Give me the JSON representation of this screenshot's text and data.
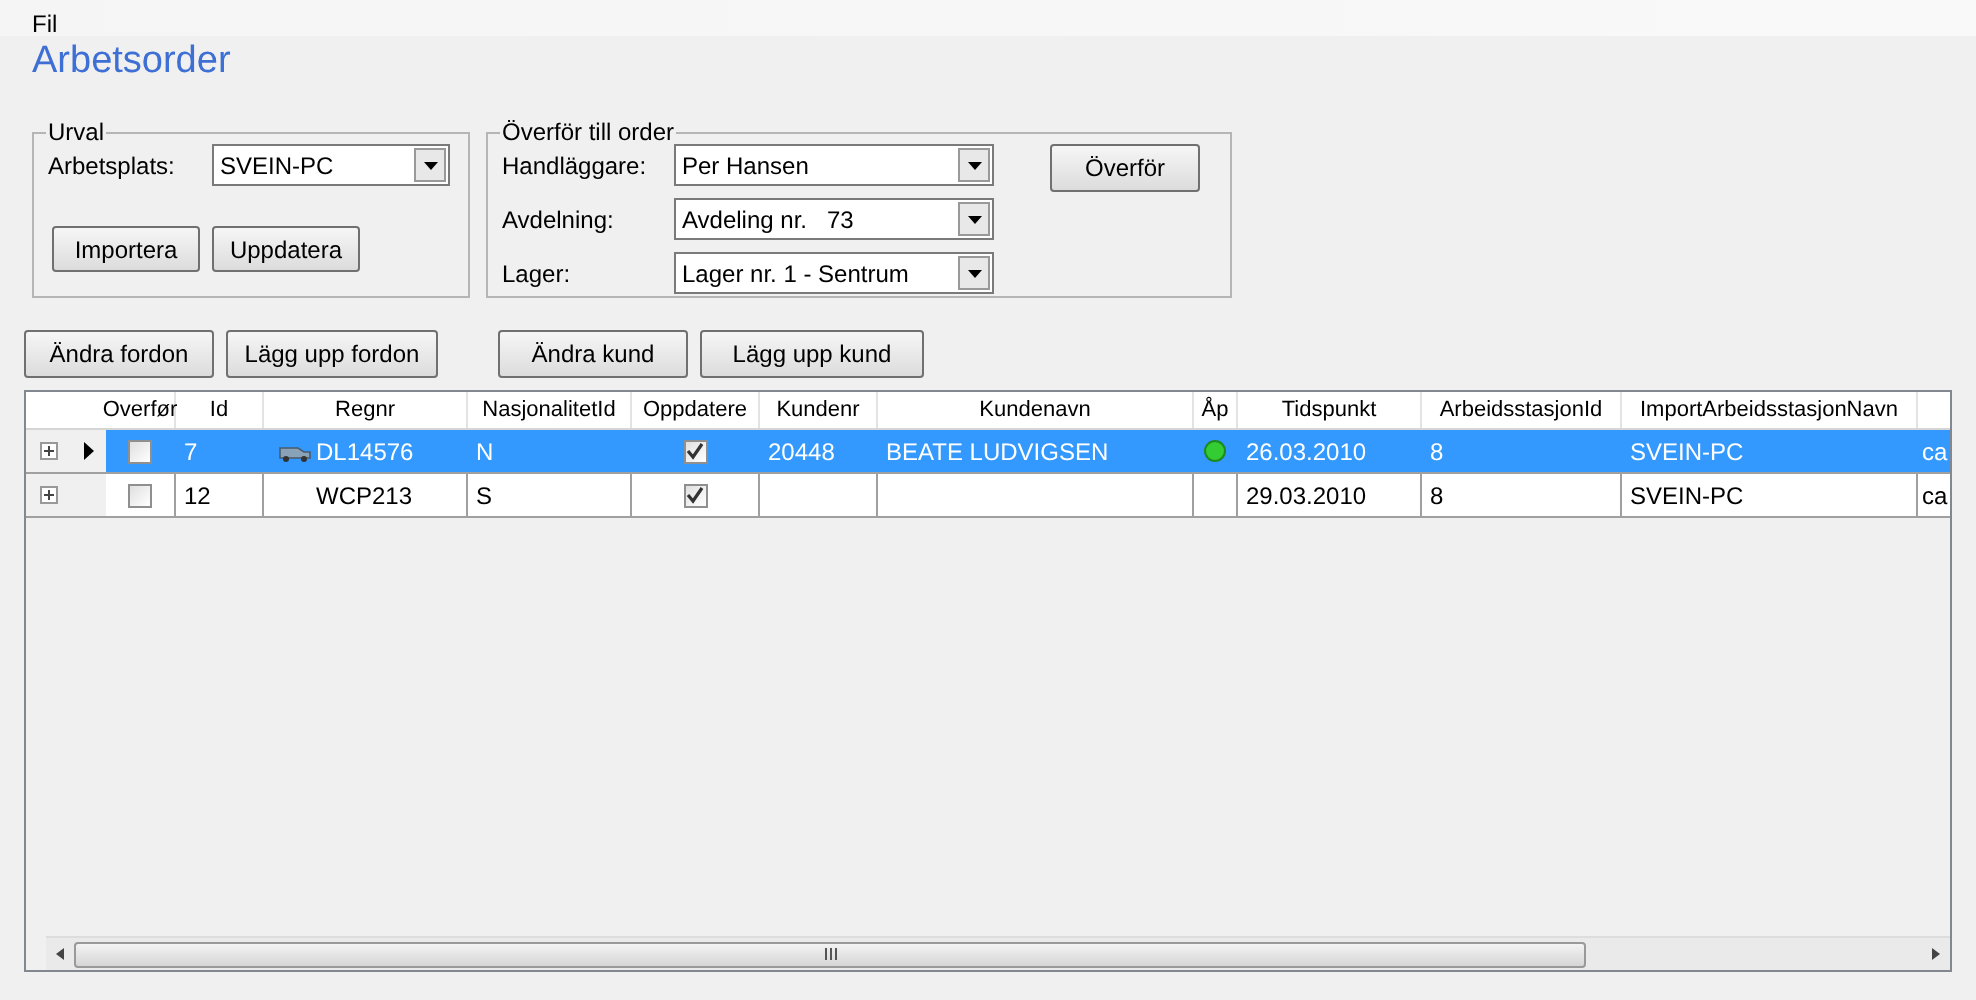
{
  "menu": [
    "Fil"
  ],
  "title": "Arbetsorder",
  "urval": {
    "legend": "Urval",
    "label": "Arbetsplats:",
    "value": "SVEIN-PC",
    "buttons": [
      "Importera",
      "Uppdatera"
    ]
  },
  "transfer": {
    "legend": "Överför till order",
    "fields": [
      {
        "label": "Handläggare:",
        "value": "Per Hansen"
      },
      {
        "label": "Avdelning:",
        "value": "Avdeling nr.   73"
      },
      {
        "label": "Lager:",
        "value": "Lager nr. 1 - Sentrum"
      }
    ],
    "button": "Överför"
  },
  "actions": [
    [
      "Ändra fordon",
      "Lägg upp fordon"
    ],
    [
      "Ändra kund",
      "Lägg upp kund"
    ]
  ],
  "table": {
    "columns": [
      "Overfør",
      "Id",
      "Regnr",
      "NasjonalitetId",
      "Oppdatere",
      "Kundenr",
      "Kundenavn",
      "Åp",
      "Tidspunkt",
      "ArbeidsstasjonId",
      "ImportArbeidsstasjonNavn"
    ],
    "rows": [
      {
        "selected": true,
        "overfor": false,
        "id": "7",
        "vehicle_icon": true,
        "regnr": "DL14576",
        "nasjonalitet": "N",
        "oppdatere": true,
        "kundenr": "20448",
        "kundenavn": "BEATE LUDVIGSEN",
        "ap": true,
        "tidspunkt": "26.03.2010",
        "stasjon": "8",
        "import": "SVEIN-PC",
        "column_12": "ca"
      },
      {
        "selected": false,
        "overfor": false,
        "id": "12",
        "vehicle_icon": false,
        "regnr": "WCP213",
        "nasjonalitet": "S",
        "oppdatere": true,
        "kundenr": "",
        "kundenavn": "",
        "ap": false,
        "tidspunkt": "29.03.2010",
        "stasjon": "8",
        "import": "SVEIN-PC",
        "column_12": "ca"
      }
    ]
  }
}
